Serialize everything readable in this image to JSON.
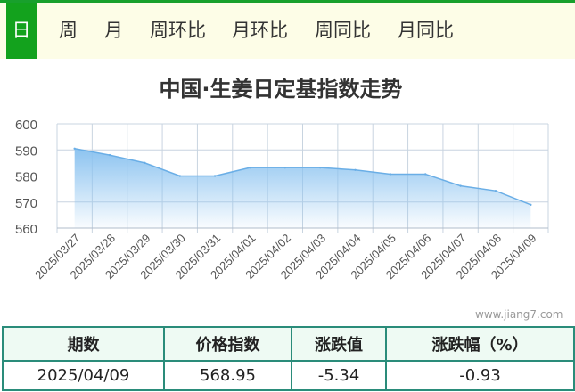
{
  "tabs": [
    {
      "label": "日",
      "active": true
    },
    {
      "label": "周"
    },
    {
      "label": "月"
    },
    {
      "label": "周环比"
    },
    {
      "label": "月环比"
    },
    {
      "label": "周同比"
    },
    {
      "label": "月同比"
    }
  ],
  "colors": {
    "accent": "#13a21d",
    "tab_bar_bg": "#fdfde7",
    "table_border": "#2a8c7a",
    "line": "#6aaee6",
    "area_top": "#8cc3f0"
  },
  "watermark": "www.jiang7.com",
  "chart_data": {
    "type": "area",
    "title": "中国·生姜日定基指数走势",
    "xlabel": "",
    "ylabel": "",
    "x": [
      "2025/03/27",
      "2025/03/28",
      "2025/03/29",
      "2025/03/30",
      "2025/03/31",
      "2025/04/01",
      "2025/04/02",
      "2025/04/03",
      "2025/04/04",
      "2025/04/05",
      "2025/04/06",
      "2025/04/07",
      "2025/04/08",
      "2025/04/09"
    ],
    "y": [
      590.5,
      588.0,
      585.0,
      580.0,
      580.0,
      583.2,
      583.2,
      583.2,
      582.3,
      580.7,
      580.7,
      576.2,
      574.3,
      568.95
    ],
    "ylim": [
      560,
      600
    ],
    "yticks": [
      560,
      570,
      580,
      590,
      600
    ],
    "grid": true,
    "legend": "none"
  },
  "summary": {
    "headers": [
      "期数",
      "价格指数",
      "涨跌值",
      "涨跌幅（%）"
    ],
    "row": [
      "2025/04/09",
      "568.95",
      "-5.34",
      "-0.93"
    ]
  }
}
